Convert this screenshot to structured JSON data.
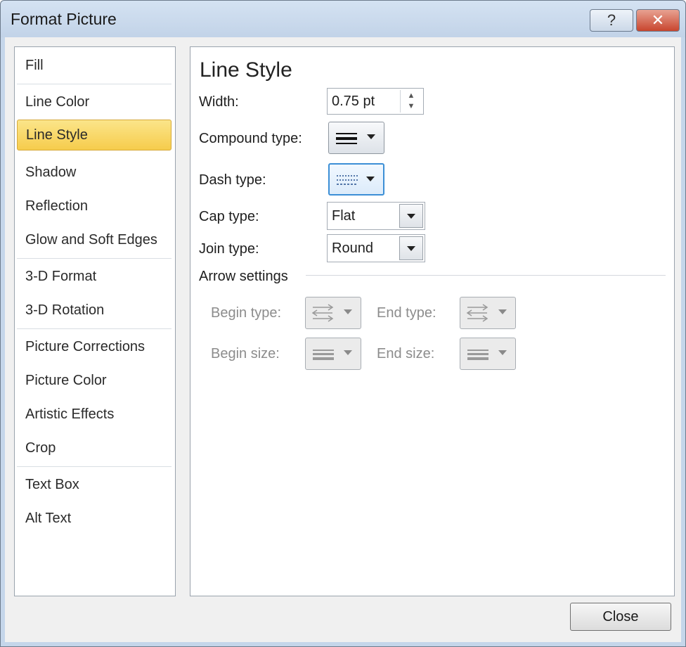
{
  "window": {
    "title": "Format Picture",
    "help_label": "?",
    "close_x_label": "✕"
  },
  "nav": {
    "items": [
      {
        "label": "Fill",
        "selected": false
      },
      {
        "label": "Line Color",
        "selected": false
      },
      {
        "label": "Line Style",
        "selected": true
      },
      {
        "label": "Shadow",
        "selected": false
      },
      {
        "label": "Reflection",
        "selected": false
      },
      {
        "label": "Glow and Soft Edges",
        "selected": false
      },
      {
        "label": "3-D Format",
        "selected": false
      },
      {
        "label": "3-D Rotation",
        "selected": false
      },
      {
        "label": "Picture Corrections",
        "selected": false
      },
      {
        "label": "Picture Color",
        "selected": false
      },
      {
        "label": "Artistic Effects",
        "selected": false
      },
      {
        "label": "Crop",
        "selected": false
      },
      {
        "label": "Text Box",
        "selected": false
      },
      {
        "label": "Alt Text",
        "selected": false
      }
    ]
  },
  "panel": {
    "title": "Line Style",
    "width_label": "Width:",
    "width_value": "0.75 pt",
    "compound_label": "Compound type:",
    "compound_icon": "compound-lines-icon",
    "dash_label": "Dash type:",
    "dash_icon": "dashed-lines-icon",
    "cap_label": "Cap type:",
    "cap_value": "Flat",
    "join_label": "Join type:",
    "join_value": "Round",
    "arrow_section": "Arrow settings",
    "begin_type_label": "Begin type:",
    "end_type_label": "End type:",
    "begin_size_label": "Begin size:",
    "end_size_label": "End size:",
    "arrow_icon": "arrow-lines-icon",
    "size_icon": "size-lines-icon"
  },
  "footer": {
    "close_label": "Close"
  },
  "colors": {
    "title_bar": "#c5d6ea",
    "selected_item": "#f6cc4c",
    "focus_border": "#3c8fd6",
    "close_x": "#c8452e"
  }
}
